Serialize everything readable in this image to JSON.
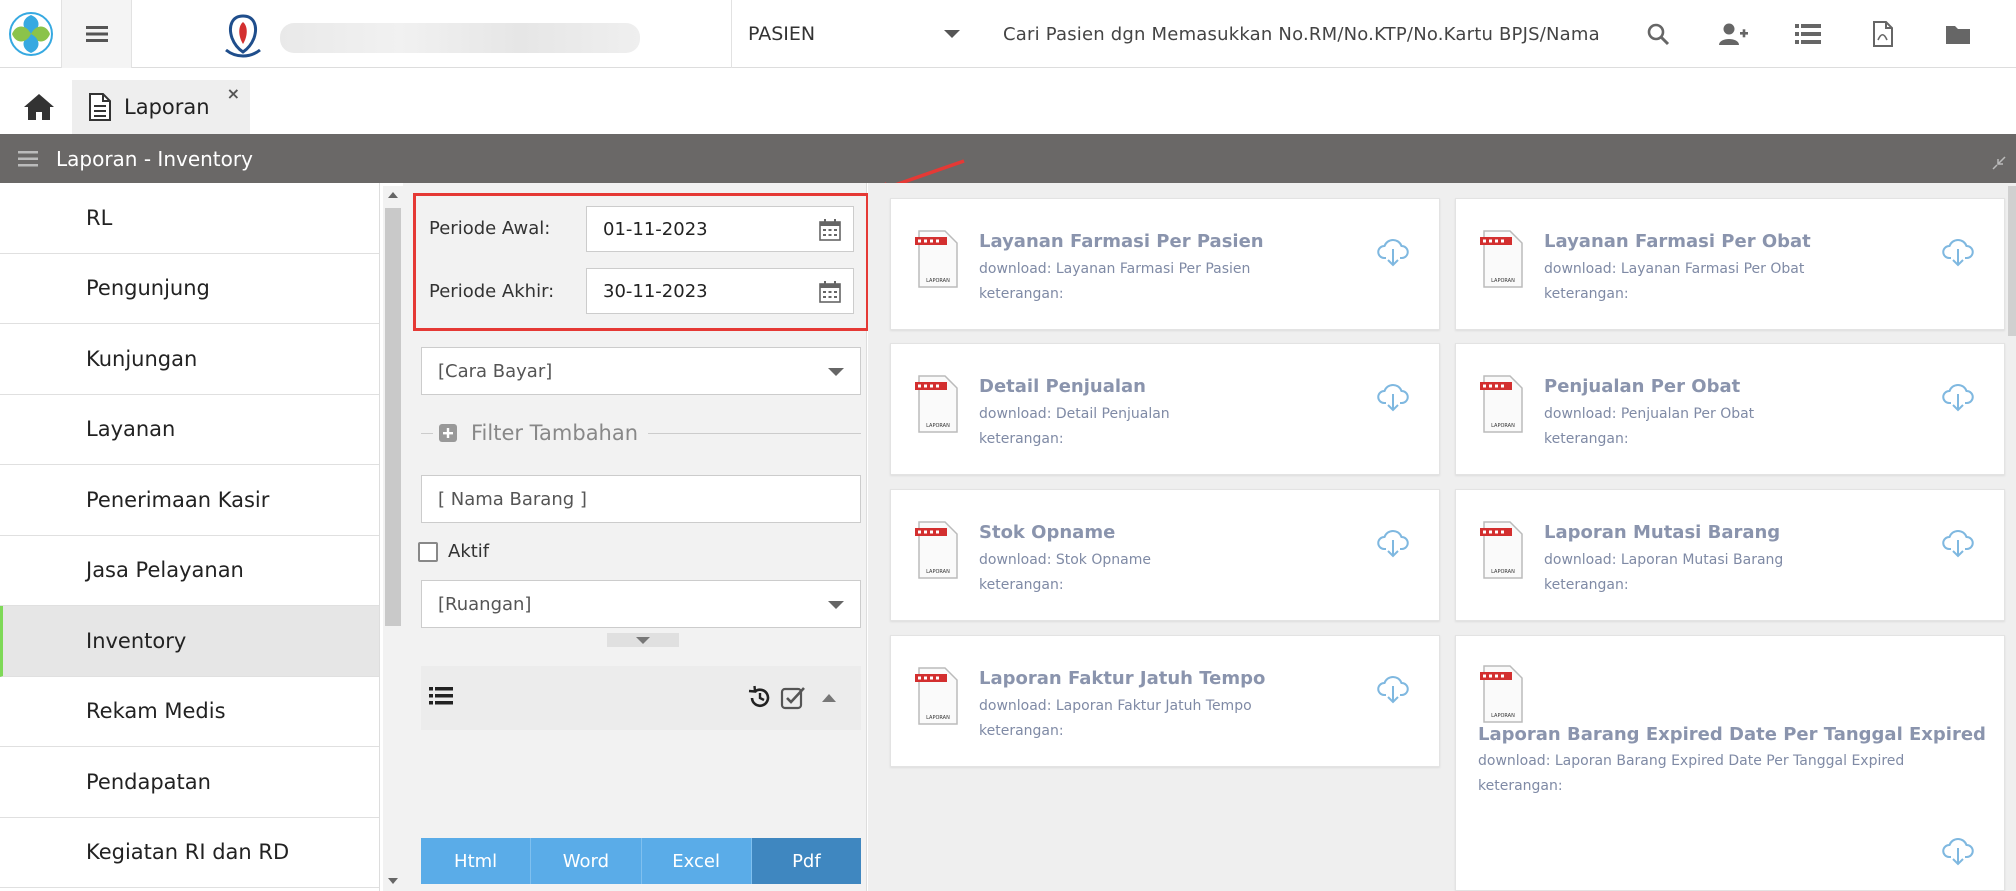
{
  "topbar": {
    "module_select": "PASIEN",
    "search_hint": "Cari Pasien dgn Memasukkan No.RM/No.KTP/No.Kartu BPJS/Nama",
    "icons": [
      "search-icon",
      "add-user-icon",
      "list-icon",
      "pdf-icon",
      "folder-icon",
      "logout-icon"
    ]
  },
  "tabs": [
    {
      "label": "Laporan",
      "close": "×"
    }
  ],
  "header": {
    "title": "Laporan - Inventory"
  },
  "sidebar": {
    "items": [
      {
        "label": "RL"
      },
      {
        "label": "Pengunjung"
      },
      {
        "label": "Kunjungan"
      },
      {
        "label": "Layanan"
      },
      {
        "label": "Penerimaan Kasir"
      },
      {
        "label": "Jasa Pelayanan"
      },
      {
        "label": "Inventory",
        "active": true
      },
      {
        "label": "Rekam Medis"
      },
      {
        "label": "Pendapatan"
      },
      {
        "label": "Kegiatan RI dan RD"
      }
    ]
  },
  "filter": {
    "periode_awal_label": "Periode Awal:",
    "periode_awal_value": "01-11-2023",
    "periode_akhir_label": "Periode Akhir:",
    "periode_akhir_value": "30-11-2023",
    "cara_bayar": "[Cara Bayar]",
    "filter_tambahan": "Filter Tambahan",
    "nama_barang_placeholder": "[ Nama Barang ]",
    "aktif_label": "Aktif",
    "ruangan": "[Ruangan]",
    "export_buttons": [
      "Html",
      "Word",
      "Excel",
      "Pdf"
    ]
  },
  "reports": [
    {
      "title": "Layanan Farmasi Per Pasien",
      "download": "download: Layanan Farmasi Per Pasien",
      "keterangan": "keterangan:"
    },
    {
      "title": "Layanan Farmasi Per Obat",
      "download": "download: Layanan Farmasi Per Obat",
      "keterangan": "keterangan:"
    },
    {
      "title": "Detail Penjualan",
      "download": "download: Detail Penjualan",
      "keterangan": "keterangan:"
    },
    {
      "title": "Penjualan Per Obat",
      "download": "download: Penjualan Per Obat",
      "keterangan": "keterangan:"
    },
    {
      "title": "Stok Opname",
      "download": "download: Stok Opname",
      "keterangan": "keterangan:"
    },
    {
      "title": "Laporan Mutasi Barang",
      "download": "download: Laporan Mutasi Barang",
      "keterangan": "keterangan:"
    },
    {
      "title": "Laporan Faktur Jatuh Tempo",
      "download": "download: Laporan Faktur Jatuh Tempo",
      "keterangan": "keterangan:"
    },
    {
      "title": "Laporan Barang Expired Date Per Tanggal Expired",
      "download": "download: Laporan Barang Expired Date Per Tanggal Expired",
      "keterangan": "keterangan:"
    }
  ],
  "doc_icon_label": "LAPORAN",
  "colors": {
    "header_bar": "#6a6867",
    "highlight_border": "#e53935",
    "export_blue": "#5aace8",
    "export_pdf": "#3f87c0",
    "active_marker": "#7ed957",
    "card_title": "#8a94ad"
  }
}
